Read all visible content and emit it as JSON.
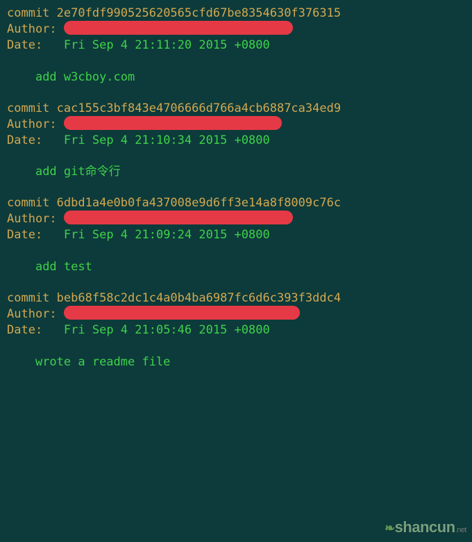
{
  "labels": {
    "commit": "commit",
    "author": "Author:",
    "date": "Date:"
  },
  "commits": [
    {
      "hash": "2e70fdf990525620565cfd67be8354630f376315",
      "date": "Fri Sep 4 21:11:20 2015 +0800",
      "message": "add w3cboy.com"
    },
    {
      "hash": "cac155c3bf843e4706666d766a4cb6887ca34ed9",
      "date": "Fri Sep 4 21:10:34 2015 +0800",
      "message": "add git命令行"
    },
    {
      "hash": "6dbd1a4e0b0fa437008e9d6ff3e14a8f8009c76c",
      "date": "Fri Sep 4 21:09:24 2015 +0800",
      "message": "add test"
    },
    {
      "hash": "beb68f58c2dc1c4a0b4ba6987fc6d6c393f3ddc4",
      "date": "Fri Sep 4 21:05:46 2015 +0800",
      "message": "wrote a readme file"
    }
  ],
  "watermark": {
    "text": "shancun",
    "suffix": ".net"
  }
}
